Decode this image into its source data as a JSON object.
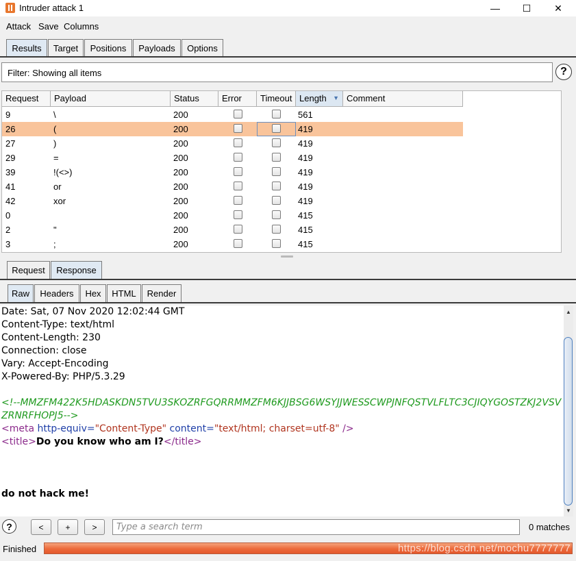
{
  "window": {
    "title": "Intruder attack 1",
    "minimize_glyph": "—",
    "maximize_glyph": "☐",
    "close_glyph": "✕"
  },
  "menu": [
    "Attack",
    "Save",
    "Columns"
  ],
  "main_tabs": [
    {
      "label": "Results",
      "active": true
    },
    {
      "label": "Target",
      "active": false
    },
    {
      "label": "Positions",
      "active": false
    },
    {
      "label": "Payloads",
      "active": false
    },
    {
      "label": "Options",
      "active": false
    }
  ],
  "filter": {
    "text": "Filter: Showing all items"
  },
  "help_glyph": "?",
  "table": {
    "columns": [
      "Request",
      "Payload",
      "Status",
      "Error",
      "Timeout",
      "Length",
      "Comment"
    ],
    "sorted_column": "Length",
    "selected_request": "26",
    "rows": [
      {
        "request": "9",
        "payload": "\\",
        "status": "200",
        "length": "561"
      },
      {
        "request": "26",
        "payload": "(",
        "status": "200",
        "length": "419"
      },
      {
        "request": "27",
        "payload": ")",
        "status": "200",
        "length": "419"
      },
      {
        "request": "29",
        "payload": "=",
        "status": "200",
        "length": "419"
      },
      {
        "request": "39",
        "payload": "!(<>)",
        "status": "200",
        "length": "419"
      },
      {
        "request": "41",
        "payload": "or",
        "status": "200",
        "length": "419"
      },
      {
        "request": "42",
        "payload": "xor",
        "status": "200",
        "length": "419"
      },
      {
        "request": "0",
        "payload": "",
        "status": "200",
        "length": "415"
      },
      {
        "request": "2",
        "payload": "\"",
        "status": "200",
        "length": "415"
      },
      {
        "request": "3",
        "payload": ";",
        "status": "200",
        "length": "415"
      }
    ]
  },
  "detail_tabs": [
    {
      "label": "Request",
      "active": false
    },
    {
      "label": "Response",
      "active": true
    }
  ],
  "view_tabs": [
    {
      "label": "Raw",
      "active": true
    },
    {
      "label": "Headers",
      "active": false
    },
    {
      "label": "Hex",
      "active": false
    },
    {
      "label": "HTML",
      "active": false
    },
    {
      "label": "Render",
      "active": false
    }
  ],
  "response": {
    "headers": [
      "Date: Sat, 07 Nov 2020 12:02:44 GMT",
      "Content-Type: text/html",
      "Content-Length: 230",
      "Connection: close",
      "Vary: Accept-Encoding",
      "X-Powered-By: PHP/5.3.29"
    ],
    "comment_line1": "<!--MMZFM422K5HDASKDN5TVU3SKOZRFGQRRMMZFM6KJJBSG6WSYJJWESSCWPJNFQSTVLFLTC3CJIQYGOSTZKJ2VSV",
    "comment_line2": "ZRNRFHOPJ5-->",
    "meta_open": "<meta",
    "meta_attr1": "http-equiv=",
    "meta_val1": "\"Content-Type\"",
    "meta_attr2": "content=",
    "meta_val2": "\"text/html; charset=utf-8\"",
    "meta_close": "/>",
    "title_open": "<title>",
    "title_text": "Do you know who am I?",
    "title_close": "</title>",
    "body_text": "do not hack me!"
  },
  "search": {
    "prev_label": "<",
    "add_label": "+",
    "next_label": ">",
    "placeholder": "Type a search term",
    "matches": "0 matches"
  },
  "status": {
    "text": "Finished",
    "progress": 1.0,
    "watermark": "https://blog.csdn.net/mochu7777777"
  },
  "colors": {
    "selected_row": "#f9c49b",
    "progress": "#ec6a3b",
    "comment": "#1f9a1f",
    "tag": "#8b2a8b",
    "attr": "#1f3fa8",
    "value": "#b0341e"
  }
}
